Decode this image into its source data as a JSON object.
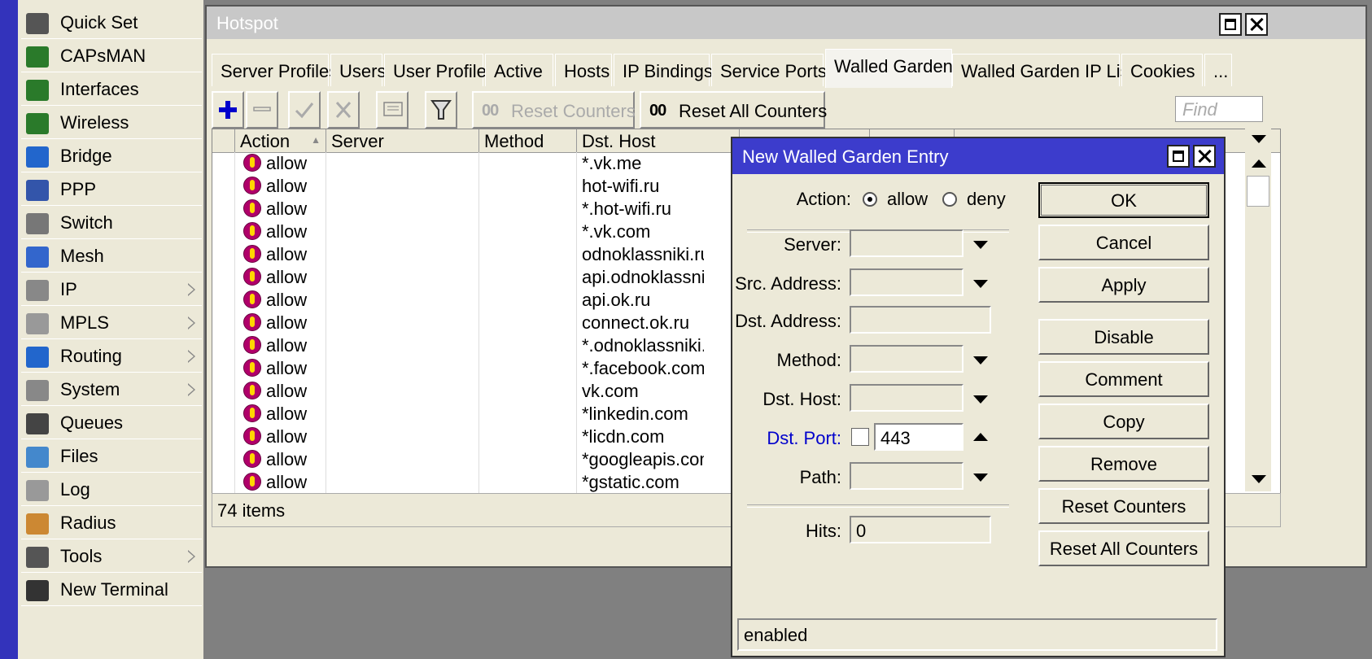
{
  "sidebar": {
    "items": [
      {
        "label": "Quick Set",
        "icon": "quickset-icon",
        "submenu": false
      },
      {
        "label": "CAPsMAN",
        "icon": "capsman-icon",
        "submenu": false
      },
      {
        "label": "Interfaces",
        "icon": "interfaces-icon",
        "submenu": false
      },
      {
        "label": "Wireless",
        "icon": "wireless-icon",
        "submenu": false
      },
      {
        "label": "Bridge",
        "icon": "bridge-icon",
        "submenu": false
      },
      {
        "label": "PPP",
        "icon": "ppp-icon",
        "submenu": false
      },
      {
        "label": "Switch",
        "icon": "switch-icon",
        "submenu": false
      },
      {
        "label": "Mesh",
        "icon": "mesh-icon",
        "submenu": false
      },
      {
        "label": "IP",
        "icon": "ip-icon",
        "submenu": true
      },
      {
        "label": "MPLS",
        "icon": "mpls-icon",
        "submenu": true
      },
      {
        "label": "Routing",
        "icon": "routing-icon",
        "submenu": true
      },
      {
        "label": "System",
        "icon": "system-icon",
        "submenu": true
      },
      {
        "label": "Queues",
        "icon": "queues-icon",
        "submenu": false
      },
      {
        "label": "Files",
        "icon": "files-icon",
        "submenu": false
      },
      {
        "label": "Log",
        "icon": "log-icon",
        "submenu": false
      },
      {
        "label": "Radius",
        "icon": "radius-icon",
        "submenu": false
      },
      {
        "label": "Tools",
        "icon": "tools-icon",
        "submenu": true
      },
      {
        "label": "New Terminal",
        "icon": "terminal-icon",
        "submenu": false
      }
    ]
  },
  "hotspot": {
    "title": "Hotspot",
    "tabs": [
      "Server Profiles",
      "Users",
      "User Profiles",
      "Active",
      "Hosts",
      "IP Bindings",
      "Service Ports",
      "Walled Garden",
      "Walled Garden IP List",
      "Cookies",
      "..."
    ],
    "active_tab": "Walled Garden",
    "toolbar": {
      "reset_counters": "Reset Counters",
      "reset_all_counters": "Reset All Counters",
      "counter_icon": "00",
      "find_placeholder": "Find"
    },
    "table": {
      "columns": [
        "Action",
        "Server",
        "Method",
        "Dst. Host"
      ],
      "rows": [
        {
          "action": "allow",
          "dst_host": "*.vk.me"
        },
        {
          "action": "allow",
          "dst_host": "hot-wifi.ru"
        },
        {
          "action": "allow",
          "dst_host": "*.hot-wifi.ru"
        },
        {
          "action": "allow",
          "dst_host": "*.vk.com"
        },
        {
          "action": "allow",
          "dst_host": "odnoklassniki.ru"
        },
        {
          "action": "allow",
          "dst_host": "api.odnoklassniki"
        },
        {
          "action": "allow",
          "dst_host": "api.ok.ru"
        },
        {
          "action": "allow",
          "dst_host": "connect.ok.ru"
        },
        {
          "action": "allow",
          "dst_host": "*.odnoklassniki."
        },
        {
          "action": "allow",
          "dst_host": "*.facebook.com"
        },
        {
          "action": "allow",
          "dst_host": "vk.com"
        },
        {
          "action": "allow",
          "dst_host": "*linkedin.com"
        },
        {
          "action": "allow",
          "dst_host": "*licdn.com"
        },
        {
          "action": "allow",
          "dst_host": "*googleapis.com"
        },
        {
          "action": "allow",
          "dst_host": "*gstatic.com"
        }
      ]
    },
    "status": "74 items"
  },
  "dialog": {
    "title": "New Walled Garden Entry",
    "fields": {
      "action_label": "Action:",
      "action_allow": "allow",
      "action_deny": "deny",
      "server_label": "Server:",
      "src_address_label": "Src. Address:",
      "dst_address_label": "Dst. Address:",
      "method_label": "Method:",
      "dst_host_label": "Dst. Host:",
      "dst_port_label": "Dst. Port:",
      "dst_port_value": "443",
      "path_label": "Path:",
      "hits_label": "Hits:",
      "hits_value": "0"
    },
    "buttons": {
      "ok": "OK",
      "cancel": "Cancel",
      "apply": "Apply",
      "disable": "Disable",
      "comment": "Comment",
      "copy": "Copy",
      "remove": "Remove",
      "reset_counters": "Reset Counters",
      "reset_all_counters": "Reset All Counters"
    },
    "status": "enabled",
    "link_color": "#0000cc"
  }
}
